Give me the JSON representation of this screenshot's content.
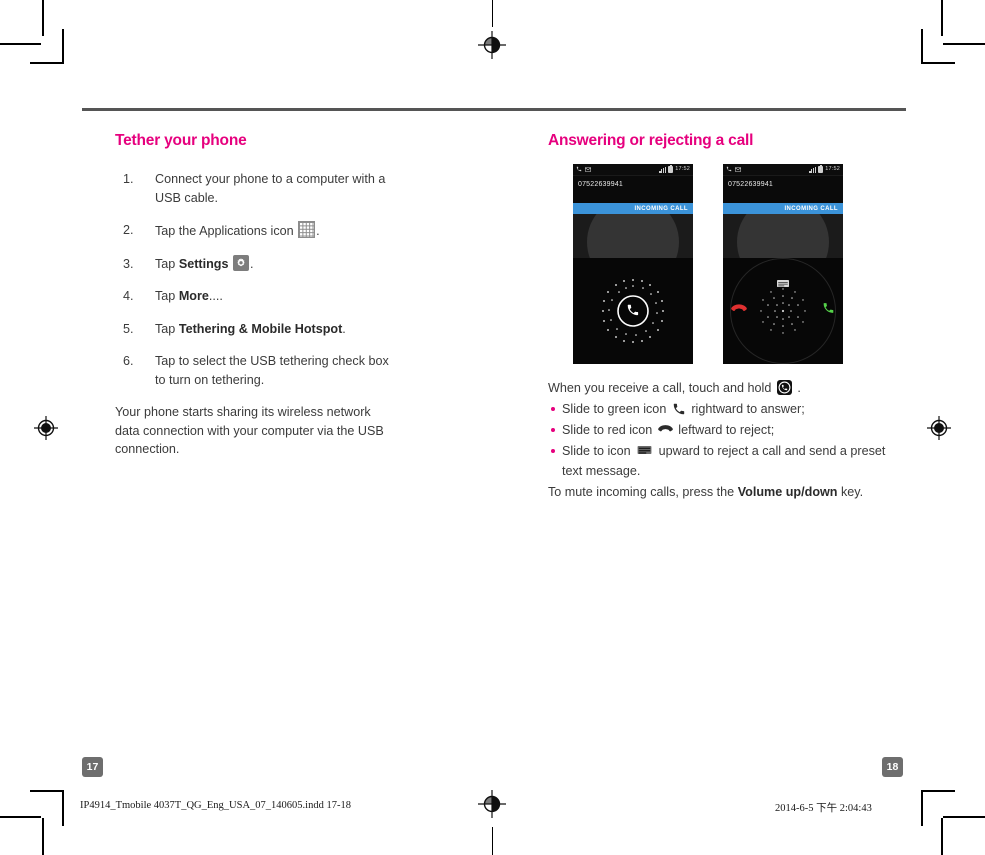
{
  "document": {
    "type": "printed-manual-spread",
    "accent_color": "#e6007e",
    "rule_color": "#555555"
  },
  "left_column": {
    "title": "Tether your phone",
    "steps": [
      {
        "num": "1.",
        "before": "Connect your phone to a computer with a USB cable.",
        "icon": "",
        "after": "",
        "bold": ""
      },
      {
        "num": "2.",
        "before": "Tap the Applications icon ",
        "icon": "apps-grid-icon",
        "after": ".",
        "bold": ""
      },
      {
        "num": "3.",
        "before": "Tap ",
        "bold": "Settings",
        "icon": "settings-gear-icon",
        "after": "."
      },
      {
        "num": "4.",
        "before": "Tap ",
        "bold": "More",
        "icon": "",
        "after": "...."
      },
      {
        "num": "5.",
        "before": "Tap ",
        "bold": "Tethering & Mobile Hotspot",
        "icon": "",
        "after": "."
      },
      {
        "num": "6.",
        "before": "Tap to select the USB tethering check box to turn on tethering.",
        "icon": "",
        "after": "",
        "bold": ""
      }
    ],
    "paragraph": "Your phone starts sharing its wireless network data connection with your computer via the USB connection."
  },
  "right_column": {
    "title": "Answering or rejecting a call",
    "phones": [
      {
        "name": "incoming-call-screen-locked",
        "status": {
          "left_icons": [
            "phone-icon",
            "message-icon"
          ],
          "signal": "signal-bars-icon",
          "battery": "battery-icon",
          "time": "17:52"
        },
        "caller_number": "07522639941",
        "banner": "INCOMING CALL",
        "center_icon": "phone-handset-icon"
      },
      {
        "name": "incoming-call-screen-expanded",
        "status": {
          "left_icons": [
            "phone-icon",
            "message-icon"
          ],
          "signal": "signal-bars-icon",
          "battery": "battery-icon",
          "time": "17:52"
        },
        "caller_number": "07522639941",
        "banner": "INCOMING CALL",
        "actions": {
          "answer": "green-handset-icon",
          "reject": "red-end-call-icon",
          "message": "message-reject-icon"
        }
      }
    ],
    "lead_text_before": "When you receive a call, touch and hold ",
    "lead_icon": "hold-phone-icon",
    "lead_text_after": " .",
    "bullets": [
      {
        "before": "Slide to green icon ",
        "icon": "green-handset-icon",
        "after": " rightward to answer;"
      },
      {
        "before": "Slide to red icon ",
        "icon": "red-end-call-icon",
        "after": " leftward to reject;"
      },
      {
        "before": "Slide to icon ",
        "icon": "message-reject-icon",
        "after": " upward to reject a call and send a preset text message."
      }
    ],
    "trailing_before": "To mute incoming calls, press the ",
    "trailing_bold": "Volume up/down",
    "trailing_after": " key."
  },
  "footer": {
    "page_left": "17",
    "page_right": "18",
    "file_info": "IP4914_Tmobile 4037T_QG_Eng_USA_07_140605.indd   17-18",
    "timestamp": "2014-6-5  下午 2:04:43"
  }
}
